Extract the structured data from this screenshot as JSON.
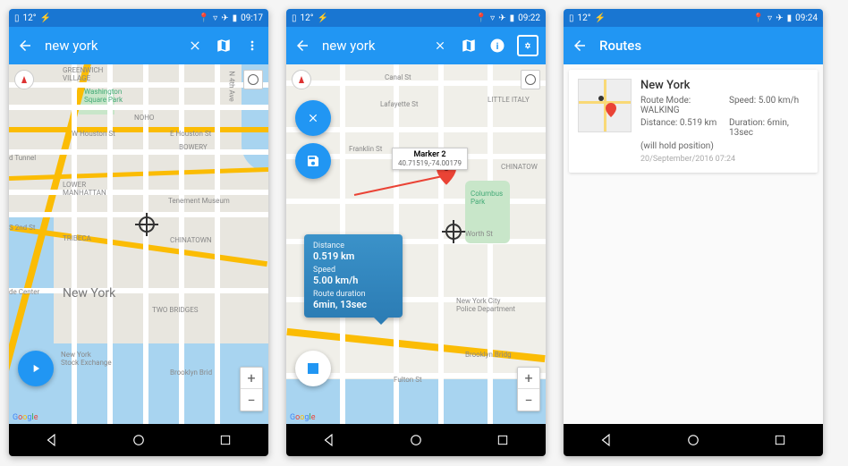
{
  "screen1": {
    "status": {
      "temp": "12°",
      "time": "09:17"
    },
    "search": "new york",
    "map": {
      "labels": {
        "greenwich": "GREENWICH\nVILLAGE",
        "wsp": "Washington\nSquare Park",
        "noho": "NOHO",
        "bowery": "BOWERY",
        "lower_manhattan": "LOWER\nMANHATTAN",
        "tribeca": "TRIBECA",
        "chinatown": "CHINATOWN",
        "two_bridges": "TWO BRIDGES",
        "newyork": "New York",
        "nyse": "New York\nStock Exchange",
        "brooklyn": "Brooklyn Brid",
        "tunnel": "d Tunnel",
        "center": "de Center",
        "tenement": "Tenement Museum",
        "houston": "W Houston St",
        "ehouston": "E Houston St",
        "n4th": "N 4th Ave",
        "s2nd": "S 2nd St"
      },
      "google": "Google"
    }
  },
  "screen2": {
    "status": {
      "temp": "12°",
      "time": "09:22"
    },
    "search": "new york",
    "marker": {
      "title": "Marker 2",
      "coords": "40.71519,-74.00179"
    },
    "info": {
      "distance_label": "Distance",
      "distance": "0.519 km",
      "speed_label": "Speed",
      "speed": "5.00 km/h",
      "duration_label": "Route duration",
      "duration": "6min, 13sec"
    },
    "map": {
      "labels": {
        "canal": "Canal St",
        "lafayette": "Lafayette St",
        "little_italy": "LITTLE ITALY",
        "franklin": "Franklin St",
        "chinatown": "CHINATOW",
        "columbus": "Columbus\nPark",
        "worth": "Worth St",
        "nypd": "New York City\nPolice Department",
        "fulton": "Fulton St",
        "brooklyn": "Brooklyn Bridg"
      },
      "google": "Google"
    }
  },
  "screen3": {
    "status": {
      "temp": "12°",
      "time": "09:24"
    },
    "title": "Routes",
    "card": {
      "title": "New York",
      "mode_label": "Route Mode:",
      "mode": "WALKING",
      "speed_label": "Speed:",
      "speed": "5.00 km/h",
      "distance_label": "Distance:",
      "distance": "0.519 km",
      "duration_label": "Duration:",
      "duration": "6min, 13sec",
      "note": "(will hold position)",
      "timestamp": "20/September/2016  07:24"
    }
  }
}
